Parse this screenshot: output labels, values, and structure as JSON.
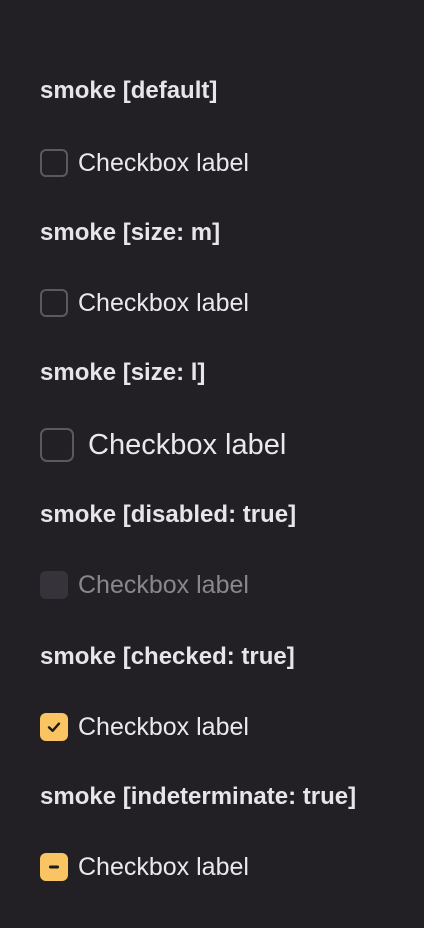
{
  "sections": [
    {
      "title": "smoke [default]",
      "checkbox_label": "Checkbox label",
      "state": "unchecked",
      "size": "default"
    },
    {
      "title": "smoke [size: m]",
      "checkbox_label": "Checkbox label",
      "state": "unchecked",
      "size": "m"
    },
    {
      "title": "smoke [size: l]",
      "checkbox_label": "Checkbox label",
      "state": "unchecked",
      "size": "l"
    },
    {
      "title": "smoke [disabled: true]",
      "checkbox_label": "Checkbox label",
      "state": "disabled",
      "size": "default"
    },
    {
      "title": "smoke [checked: true]",
      "checkbox_label": "Checkbox label",
      "state": "checked",
      "size": "default"
    },
    {
      "title": "smoke [indeterminate: true]",
      "checkbox_label": "Checkbox label",
      "state": "indeterminate",
      "size": "default"
    }
  ],
  "colors": {
    "background": "#222024",
    "accent": "#fbc463",
    "text": "#e9e8ec",
    "border": "#5b5861",
    "disabled": "#36333a"
  }
}
